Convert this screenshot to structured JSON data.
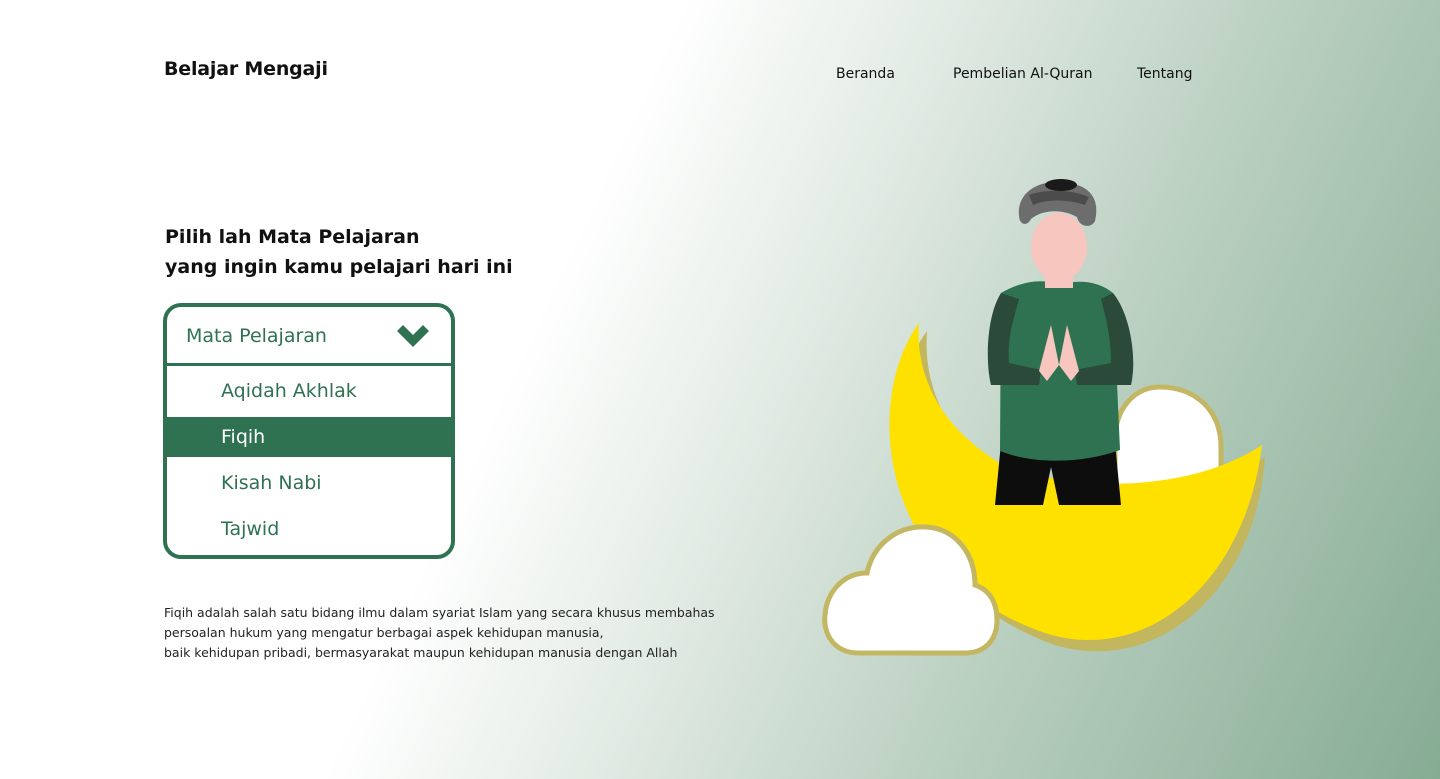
{
  "brand": {
    "title": "Belajar Mengaji"
  },
  "nav": {
    "items": [
      "Beranda",
      "Pembelian Al-Quran",
      "Tentang"
    ]
  },
  "hero": {
    "headline_line1": "Pilih lah Mata Pelajaran",
    "headline_line2": "yang ingin kamu pelajari hari ini"
  },
  "subject_select": {
    "label": "Mata Pelajaran",
    "options": [
      "Aqidah Akhlak",
      "Fiqih",
      "Kisah Nabi",
      "Tajwid"
    ],
    "selected": "Fiqih"
  },
  "description": {
    "line1": "Fiqih adalah salah satu bidang ilmu dalam syariat Islam yang secara khusus membahas",
    "line2": "persoalan hukum yang mengatur berbagai aspek kehidupan manusia,",
    "line3": "baik kehidupan pribadi, bermasyarakat maupun kehidupan manusia dengan Allah"
  },
  "colors": {
    "accent": "#2f7252",
    "moon": "#ffe100",
    "moon_shadow": "#c2b65e",
    "cloud_outline": "#c3b764",
    "shirt": "#2f7252",
    "sleeve": "#2b4a3a",
    "turban": "#6d6d6d",
    "skin": "#f7c6be"
  },
  "icons": {
    "dropdown": "chevron-down-icon"
  }
}
